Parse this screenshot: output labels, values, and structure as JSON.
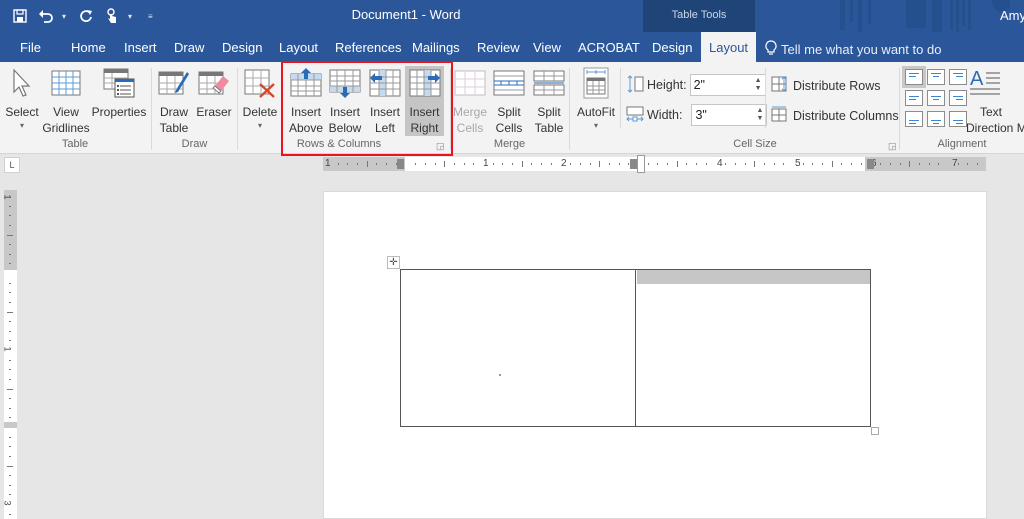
{
  "titlebar": {
    "doc_title": "Document1 - Word",
    "contextual_label": "Table Tools",
    "user": "Amy",
    "qat": [
      {
        "icon": "save-icon"
      },
      {
        "icon": "undo-icon"
      },
      {
        "icon": "redo-icon"
      },
      {
        "icon": "touch-mode-icon"
      },
      {
        "icon": "customize-qat-icon"
      }
    ]
  },
  "tabs": [
    {
      "label": "File"
    },
    {
      "label": "Home"
    },
    {
      "label": "Insert"
    },
    {
      "label": "Draw"
    },
    {
      "label": "Design"
    },
    {
      "label": "Layout"
    },
    {
      "label": "References"
    },
    {
      "label": "Mailings"
    },
    {
      "label": "Review"
    },
    {
      "label": "View"
    },
    {
      "label": "ACROBAT"
    },
    {
      "label": "Design"
    },
    {
      "label": "Layout",
      "active": true
    }
  ],
  "tell_me": "Tell me what you want to do",
  "ribbon": {
    "table_group": {
      "label": "Table",
      "select": "Select",
      "view": "View",
      "gridlines": "Gridlines",
      "properties": "Properties"
    },
    "draw_group": {
      "label": "Draw",
      "draw": "Draw",
      "table": "Table",
      "eraser": "Eraser"
    },
    "delete": "Delete",
    "rows_cols_group": {
      "label": "Rows & Columns",
      "insert": "Insert",
      "above": "Above",
      "below": "Below",
      "left": "Left",
      "right": "Right"
    },
    "merge_group": {
      "label": "Merge",
      "merge": "Merge",
      "cells": "Cells",
      "split": "Split",
      "table": "Table"
    },
    "cell_size_group": {
      "label": "Cell Size",
      "autofit": "AutoFit",
      "height_label": "Height:",
      "height_value": "2\"",
      "width_label": "Width:",
      "width_value": "3\"",
      "distribute_rows": "Distribute Rows",
      "distribute_columns": "Distribute Columns"
    },
    "alignment_group": {
      "label": "Alignment",
      "text": "Text",
      "direction": "Direction",
      "overflow": "M"
    }
  },
  "ruler": {
    "corner": "L",
    "h_numbers": [
      "1",
      "1",
      "2",
      "4",
      "5",
      "6",
      "7"
    ],
    "v_numbers": [
      "1",
      "1",
      "3"
    ]
  },
  "colors": {
    "brand_blue": "#2b579a",
    "contextual_dark": "#1f4478",
    "highlight_red": "#e8141e"
  }
}
